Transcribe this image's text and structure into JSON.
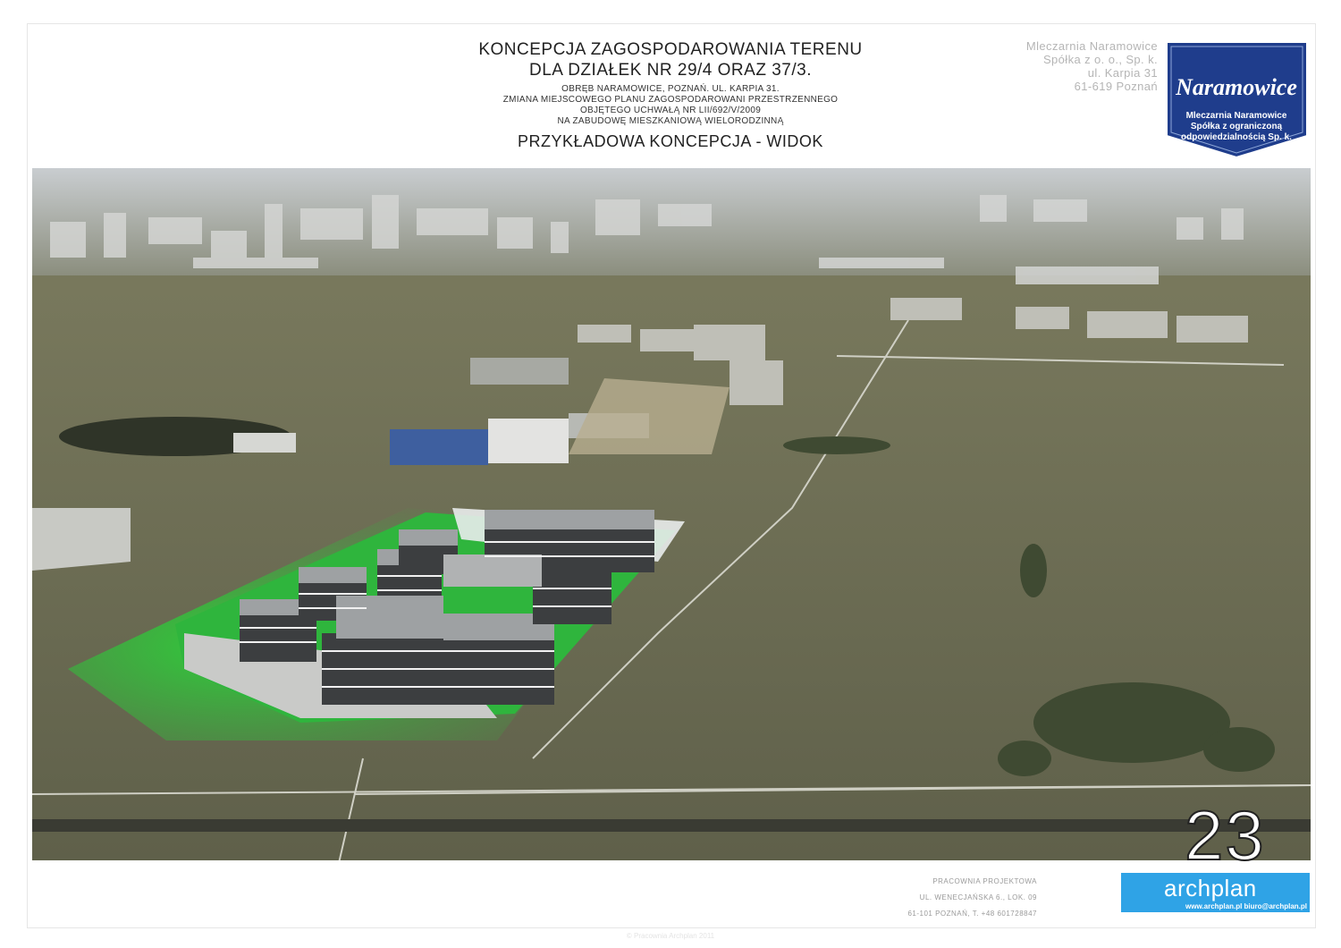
{
  "header": {
    "title_line1": "KONCEPCJA ZAGOSPODAROWANIA TERENU",
    "title_line2": "DLA DZIAŁEK NR 29/4 ORAZ 37/3.",
    "detail_line1": "OBRĘB NARAMOWICE, POZNAŃ. UL. KARPIA 31.",
    "detail_line2": "ZMIANA MIEJSCOWEGO PLANU ZAGOSPODAROWANI PRZESTRZENNEGO",
    "detail_line3": "OBJĘTEGO UCHWAŁĄ NR  LII/692/V/2009",
    "detail_line4": "NA ZABUDOWĘ MIESZKANIOWĄ WIELORODZINNĄ",
    "subtitle": "PRZYKŁADOWA KONCEPCJA - WIDOK"
  },
  "owner": {
    "line1": "Mleczarnia Naramowice",
    "line2": "Spółka z o. o., Sp. k.",
    "line3": "ul. Karpia 31",
    "line4": "61-619 Poznań"
  },
  "badge": {
    "brand": "Naramowice",
    "line1": "Mleczarnia Naramowice",
    "line2": "Spółka z ograniczoną",
    "line3": "odpowiedzialnością Sp. k.",
    "color": "#1f3d8c"
  },
  "sheet": {
    "number": "23"
  },
  "studio": {
    "line1": "PRACOWNIA PROJEKTOWA",
    "line2": "UL. WENECJAŃSKA 6., LOK. 09",
    "line3": "61-101 POZNAŃ, T. +48 601728847",
    "logo": "archplan",
    "web": "www.archplan.pl biuro@archplan.pl",
    "color": "#2fa3e6"
  },
  "footer": {
    "note": "© Pracownia Archplan 2011"
  }
}
